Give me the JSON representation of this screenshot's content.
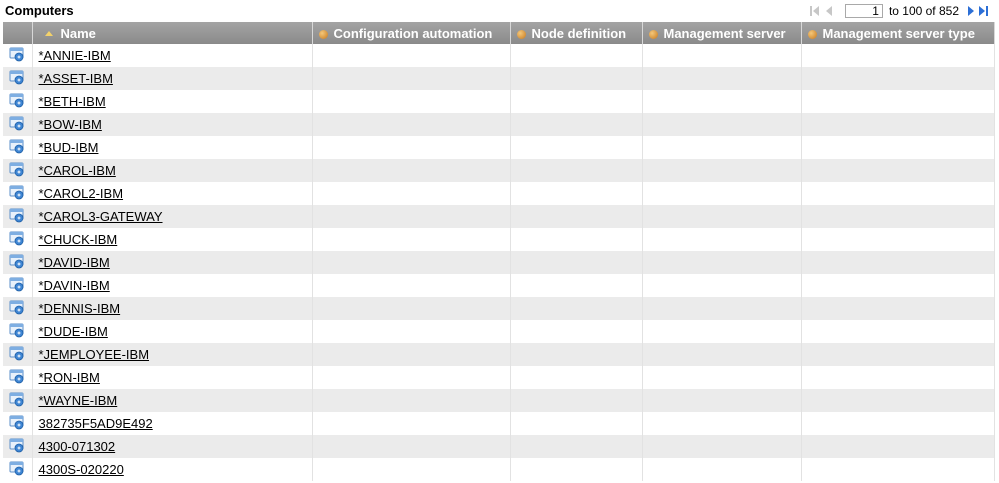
{
  "header": {
    "title": "Computers"
  },
  "pager": {
    "current_page": "1",
    "range_text": "to 100 of 852"
  },
  "icons": {
    "row_icon": "computer-icon",
    "column_icon": "property-icon",
    "sort_icon": "sort-ascending-icon"
  },
  "colors": {
    "header_bg": "#999999",
    "row_alt": "#ebebeb",
    "accent": "#2c6fd6"
  },
  "table": {
    "columns": [
      "Name",
      "Configuration automation",
      "Node definition",
      "Management server",
      "Management server type"
    ],
    "rows": [
      "*ANNIE-IBM",
      "*ASSET-IBM",
      "*BETH-IBM",
      "*BOW-IBM",
      "*BUD-IBM",
      "*CAROL-IBM",
      "*CAROL2-IBM",
      "*CAROL3-GATEWAY",
      "*CHUCK-IBM",
      "*DAVID-IBM",
      "*DAVIN-IBM",
      "*DENNIS-IBM",
      "*DUDE-IBM",
      "*JEMPLOYEE-IBM",
      "*RON-IBM",
      "*WAYNE-IBM",
      "382735F5AD9E492",
      "4300-071302",
      "4300S-020220"
    ]
  }
}
